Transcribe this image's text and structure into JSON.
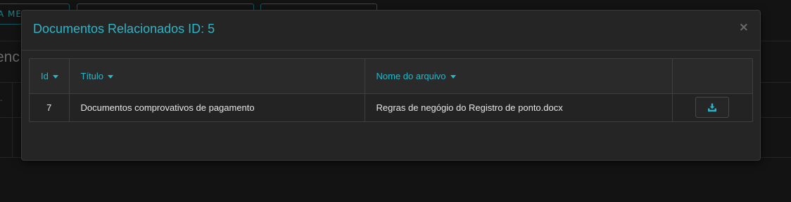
{
  "background": {
    "buttons": [
      "A ME",
      "",
      ""
    ],
    "heading": "enc",
    "tick": "-"
  },
  "modal": {
    "title": "Documentos Relacionados ID: 5",
    "close_label": "×",
    "table": {
      "headers": [
        "Id",
        "Título",
        "Nome do arquivo",
        ""
      ],
      "rows": [
        {
          "id": "7",
          "titulo": "Documentos comprovativos de pagamento",
          "arquivo": "Regras de negógio do Registro de ponto.docx"
        }
      ]
    },
    "download_icon": "download-tray-icon",
    "accent_color": "#2ab6c9"
  }
}
